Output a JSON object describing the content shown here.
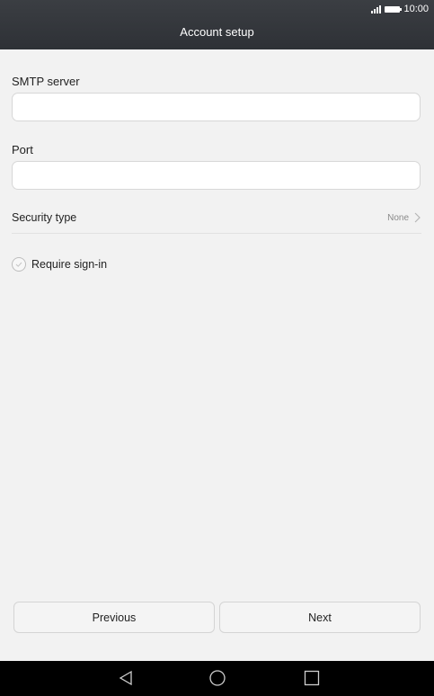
{
  "status_bar": {
    "time": "10:00",
    "icons": [
      "signal-icon",
      "battery-icon"
    ]
  },
  "header": {
    "title": "Account setup"
  },
  "form": {
    "smtp_server": {
      "label": "SMTP server",
      "value": "",
      "placeholder": ""
    },
    "port": {
      "label": "Port",
      "value": "",
      "placeholder": ""
    },
    "security_type": {
      "label": "Security type",
      "value": "None"
    },
    "require_signin": {
      "label": "Require sign-in",
      "checked": false
    }
  },
  "buttons": {
    "previous": "Previous",
    "next": "Next"
  },
  "nav_bar": {
    "icons": [
      "back-icon",
      "home-icon",
      "recent-apps-icon"
    ]
  },
  "colors": {
    "app_bar": "#2e3136",
    "background": "#f2f2f2",
    "nav_bar": "#000000"
  }
}
